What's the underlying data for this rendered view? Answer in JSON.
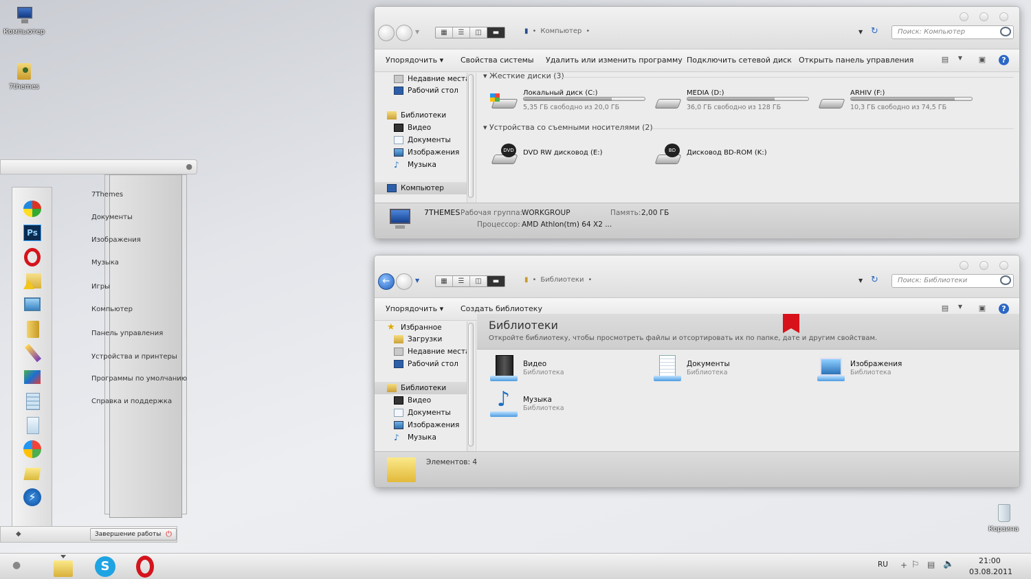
{
  "desktop": {
    "computer_label": "Компьютер",
    "themes_label": "7themes",
    "recycle_label": "Корзина"
  },
  "win1": {
    "address": "Компьютер",
    "search_placeholder": "Поиск: Компьютер",
    "toolbar": [
      "Упорядочить",
      "Свойства системы",
      "Удалить или изменить программу",
      "Подключить сетевой диск",
      "Открыть панель управления"
    ],
    "nav": [
      "Недавние места",
      "Рабочий стол",
      "Библиотеки",
      "Видео",
      "Документы",
      "Изображения",
      "Музыка",
      "Компьютер"
    ],
    "section_hdd": "Жесткие диски (3)",
    "section_removable": "Устройства со съемными носителями (2)",
    "drives": [
      {
        "name": "Локальный диск (C:)",
        "free": "5,35 ГБ свободно из 20,0 ГБ",
        "used_fraction": 0.73
      },
      {
        "name": "MEDIA (D:)",
        "free": "36,0 ГБ свободно из 128 ГБ",
        "used_fraction": 0.72
      },
      {
        "name": "ARHIV (F:)",
        "free": "10,3 ГБ свободно из 74,5 ГБ",
        "used_fraction": 0.86
      }
    ],
    "removable": [
      {
        "name": "DVD RW дисковод (E:)",
        "badge": "DVD"
      },
      {
        "name": "Дисковод BD-ROM (K:)",
        "badge": "BD"
      }
    ],
    "status": {
      "pc_name": "7THEMES",
      "workgroup_label": "Рабочая группа:",
      "workgroup": "WORKGROUP",
      "memory_label": "Память:",
      "memory": "2,00 ГБ",
      "cpu_label": "Процессор:",
      "cpu": "AMD Athlon(tm) 64 X2 ..."
    }
  },
  "win2": {
    "address": "Библиотеки",
    "search_placeholder": "Поиск: Библиотеки",
    "toolbar": [
      "Упорядочить",
      "Создать библиотеку"
    ],
    "nav": [
      "Избранное",
      "Загрузки",
      "Недавние места",
      "Рабочий стол",
      "Библиотеки",
      "Видео",
      "Документы",
      "Изображения",
      "Музыка"
    ],
    "header_title": "Библиотеки",
    "header_desc": "Откройте библиотеку, чтобы просмотреть файлы и отсортировать их по папке, дате и другим свойствам.",
    "libs": [
      {
        "name": "Видео",
        "sub": "Библиотека"
      },
      {
        "name": "Документы",
        "sub": "Библиотека"
      },
      {
        "name": "Изображения",
        "sub": "Библиотека"
      },
      {
        "name": "Музыка",
        "sub": "Библиотека"
      }
    ],
    "status": "Элементов: 4"
  },
  "start": {
    "items": [
      "7Themes",
      "Документы",
      "Изображения",
      "Музыка",
      "Игры",
      "Компьютер",
      "Панель управления",
      "Устройства и принтеры",
      "Программы по умолчанию",
      "Справка и поддержка"
    ],
    "shutdown": "Завершение работы",
    "ps_label": "Ps"
  },
  "taskbar": {
    "lang": "RU",
    "time": "21:00",
    "date": "03.08.2011"
  },
  "colors": {
    "accent": "#1f5fbd",
    "opera_red": "#d4141c",
    "skype_blue": "#1ea3e3",
    "bookmark_red": "#d8121a"
  }
}
